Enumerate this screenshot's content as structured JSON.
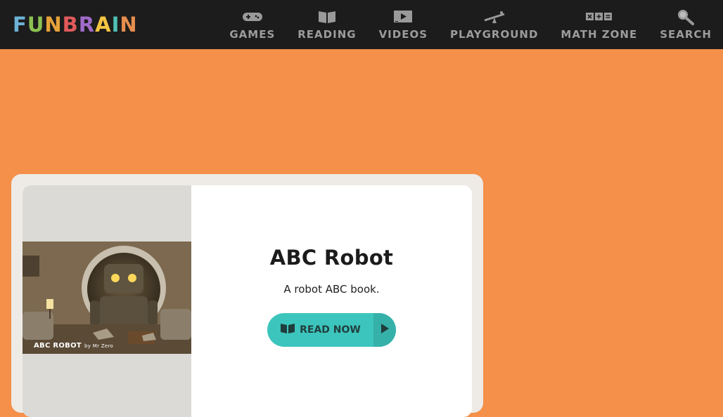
{
  "header": {
    "logo": {
      "letters": [
        "F",
        "U",
        "N",
        "B",
        "R",
        "A",
        "I",
        "N"
      ],
      "colors": [
        "#6db3d6",
        "#8cc152",
        "#e8a23a",
        "#e05a5a",
        "#a06bc8",
        "#f4c542",
        "#4fc1b6",
        "#e58e4e"
      ]
    },
    "nav": [
      {
        "label": "GAMES",
        "icon": "gamepad-icon"
      },
      {
        "label": "READING",
        "icon": "book-icon"
      },
      {
        "label": "VIDEOS",
        "icon": "video-icon"
      },
      {
        "label": "PLAYGROUND",
        "icon": "seesaw-icon"
      },
      {
        "label": "MATH ZONE",
        "icon": "math-symbols-icon"
      },
      {
        "label": "SEARCH",
        "icon": "magnifier-icon"
      }
    ]
  },
  "feature": {
    "title": "ABC Robot",
    "description": "A robot ABC book.",
    "thumbnail": {
      "caption": "ABC ROBOT",
      "byline": "by Mr Zero"
    },
    "button": {
      "label": "READ NOW",
      "icon": "open-book-icon",
      "arrow_icon": "play-icon"
    }
  },
  "colors": {
    "page_bg": "#f5904a",
    "topbar": "#1d1c1c",
    "accent": "#3cc5bd"
  }
}
